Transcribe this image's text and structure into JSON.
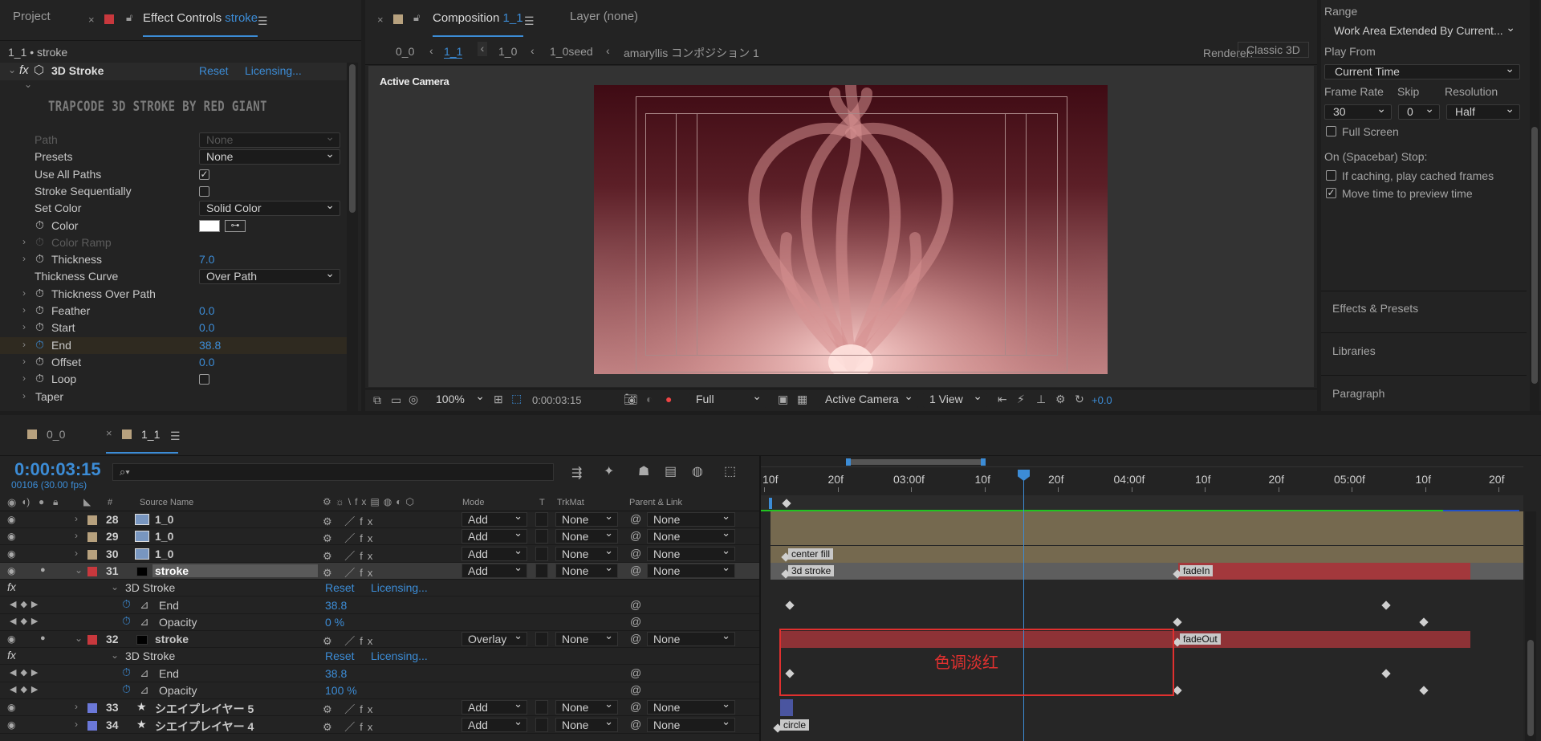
{
  "left_panel": {
    "tab_project": "Project",
    "tab_effect_controls": "Effect Controls",
    "tab_effect_layer": "stroke",
    "breadcrumb": "1_1 • stroke",
    "effect_name": "3D Stroke",
    "reset": "Reset",
    "licensing": "Licensing...",
    "banner": "TRAPCODE 3D STROKE BY RED GIANT",
    "props": [
      {
        "label": "Path",
        "value": "None",
        "kind": "dropdown-disabled"
      },
      {
        "label": "Presets",
        "value": "None",
        "kind": "dropdown"
      },
      {
        "label": "Use All Paths",
        "value": "✓",
        "kind": "checkbox"
      },
      {
        "label": "Stroke Sequentially",
        "value": "",
        "kind": "checkbox"
      },
      {
        "label": "Set Color",
        "value": "Solid Color",
        "kind": "dropdown"
      },
      {
        "label": "Color",
        "value": "",
        "kind": "color"
      },
      {
        "label": "Color Ramp",
        "value": "",
        "kind": "disabled"
      },
      {
        "label": "Thickness",
        "value": "7.0",
        "kind": "number"
      },
      {
        "label": "Thickness Curve",
        "value": "Over Path",
        "kind": "dropdown"
      },
      {
        "label": "Thickness Over Path",
        "value": "",
        "kind": "group"
      },
      {
        "label": "Feather",
        "value": "0.0",
        "kind": "number"
      },
      {
        "label": "Start",
        "value": "0.0",
        "kind": "number"
      },
      {
        "label": "End",
        "value": "38.8",
        "kind": "number"
      },
      {
        "label": "Offset",
        "value": "0.0",
        "kind": "number"
      },
      {
        "label": "Loop",
        "value": "",
        "kind": "checkbox"
      },
      {
        "label": "Taper",
        "value": "",
        "kind": "group"
      }
    ]
  },
  "comp_panel": {
    "tab_composition": "Composition",
    "tab_comp_name": "1_1",
    "tab_layer": "Layer  (none)",
    "flow": [
      "0_0",
      "1_1",
      "1_0",
      "1_0seed",
      "amaryllis コンポジション 1"
    ],
    "renderer_label": "Renderer:",
    "renderer_value": "Classic 3D",
    "active_camera_label": "Active Camera",
    "zoom": "100%",
    "timecode": "0:00:03:15",
    "resolution": "Full",
    "camera": "Active Camera",
    "view": "1 View",
    "exposure": "+0.0"
  },
  "preview_panel": {
    "range_label": "Range",
    "range_value": "Work Area Extended By Current...",
    "play_from_label": "Play From",
    "play_from_value": "Current Time",
    "frame_rate_label": "Frame Rate",
    "skip_label": "Skip",
    "resolution_label": "Resolution",
    "frame_rate_value": "30",
    "skip_value": "0",
    "resolution_value": "Half",
    "full_screen": "Full Screen",
    "on_stop_label": "On (Spacebar) Stop:",
    "if_caching": "If caching, play cached frames",
    "move_time": "Move time to preview time",
    "effects_presets": "Effects & Presets",
    "libraries": "Libraries",
    "paragraph": "Paragraph"
  },
  "timeline": {
    "tab_a": "0_0",
    "tab_b": "1_1",
    "timecode": "0:00:03:15",
    "frames": "00106 (30.00 fps)",
    "search_placeholder": "",
    "col_num": "#",
    "col_source": "Source Name",
    "col_mode": "Mode",
    "col_t": "T",
    "col_trkmat": "TrkMat",
    "col_parent": "Parent & Link",
    "ruler": [
      "10f",
      "20f",
      "03:00f",
      "10f",
      "20f",
      "04:00f",
      "10f",
      "20f",
      "05:00f",
      "10f",
      "20f"
    ],
    "layers": [
      {
        "num": "28",
        "name": "1_0",
        "mode": "Add",
        "trkmat": "None",
        "parent": "None",
        "color": "#b7a17e"
      },
      {
        "num": "29",
        "name": "1_0",
        "mode": "Add",
        "trkmat": "None",
        "parent": "None",
        "color": "#b7a17e"
      },
      {
        "num": "30",
        "name": "1_0",
        "mode": "Add",
        "trkmat": "None",
        "parent": "None",
        "color": "#b7a17e"
      },
      {
        "num": "31",
        "name": "stroke",
        "mode": "Add",
        "trkmat": "None",
        "parent": "None",
        "color": "#c8383d"
      }
    ],
    "layer31_effect": "3D Stroke",
    "layer31_end_label": "End",
    "layer31_end_value": "38.8",
    "layer31_opacity_label": "Opacity",
    "layer31_opacity_value": "0 %",
    "layer32": {
      "num": "32",
      "name": "stroke",
      "mode": "Overlay",
      "trkmat": "None",
      "parent": "None",
      "color": "#c8383d"
    },
    "layer32_effect": "3D Stroke",
    "layer32_end_label": "End",
    "layer32_end_value": "38.8",
    "layer32_opacity_label": "Opacity",
    "layer32_opacity_value": "100 %",
    "reset": "Reset",
    "licensing": "Licensing...",
    "layers_bottom": [
      {
        "num": "33",
        "name": "シエイプレイヤー 5",
        "mode": "Add",
        "trkmat": "None",
        "parent": "None",
        "color": "#6b78d8"
      },
      {
        "num": "34",
        "name": "シエイプレイヤー 4",
        "mode": "Add",
        "trkmat": "None",
        "parent": "None",
        "color": "#6b78d8"
      }
    ],
    "markers": {
      "center_fill": "center fill",
      "stroke3d": "3d stroke",
      "fadein": "fadeIn",
      "fadeout": "fadeOut",
      "circle": "circle"
    },
    "annotation": "色调淡红"
  },
  "colors": {
    "accent": "#3c8cd6",
    "layer_red": "#c8383d",
    "layer_tan": "#b7a17e",
    "annotation": "#e0302f"
  }
}
